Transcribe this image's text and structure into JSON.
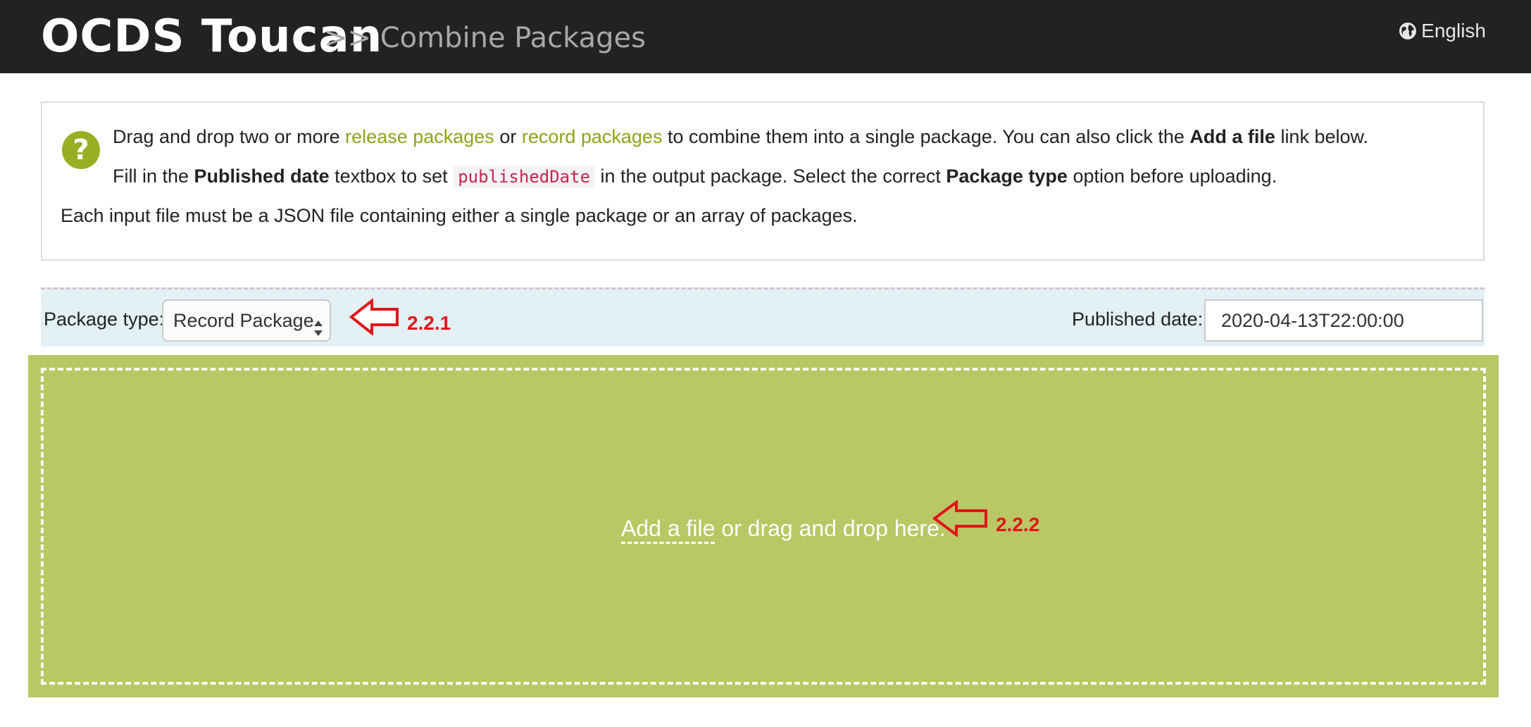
{
  "header": {
    "brand": "OCDS Toucan",
    "breadcrumb": ">> Combine Packages",
    "language": "English",
    "language_icon": "globe-icon",
    "bg_color": "#222222"
  },
  "help": {
    "icon": "question-icon",
    "accent_color": "#9aae23",
    "line1": {
      "t1": "Drag and drop two or more ",
      "link1": "release packages",
      "t2": " or ",
      "link2": "record packages",
      "t3": " to combine them into a single package. You can also click the ",
      "bold1": "Add a file",
      "t4": " link below."
    },
    "line2": {
      "t1": "Fill in the ",
      "bold1": "Published date",
      "t2": " textbox to set ",
      "code": "publishedDate",
      "t3": " in the output package. Select the correct ",
      "bold2": "Package type",
      "t4": " option before uploading."
    },
    "line3": "Each input file must be a JSON file containing either a single package or an array of packages."
  },
  "options": {
    "package_type_label": "Package type:",
    "package_type_value": "Record Package",
    "published_date_label": "Published date:",
    "published_date_value": "2020-04-13T22:00:00"
  },
  "dropzone": {
    "add_file_link": "Add a file",
    "rest": " or drag and drop here.",
    "bg_color": "#b9c764"
  },
  "annotations": {
    "a1": "2.2.1",
    "a2": "2.2.2",
    "color": "#e1141b"
  }
}
